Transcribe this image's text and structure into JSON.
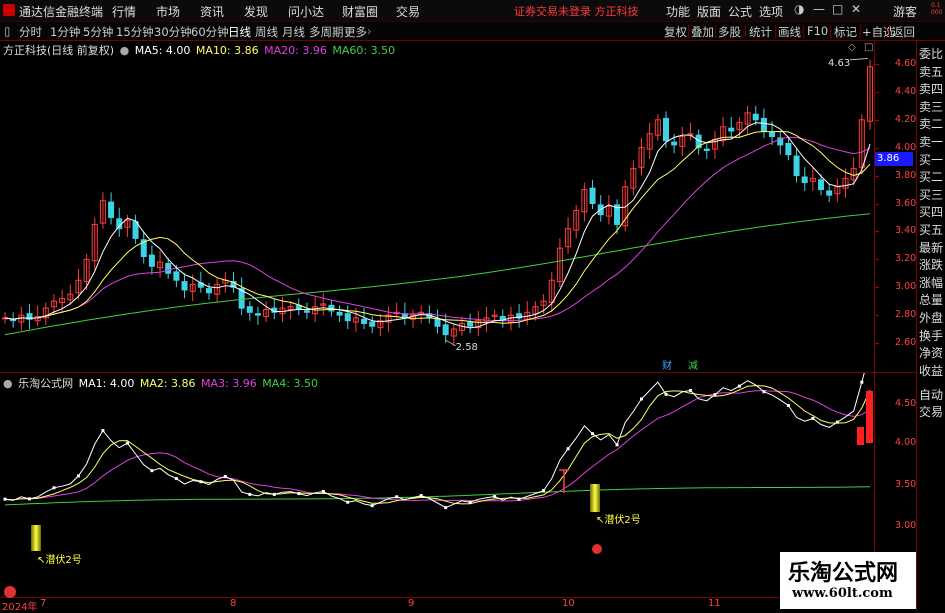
{
  "topbar": {
    "brand": "通达信金融终端",
    "menu": [
      "行情",
      "市场",
      "资讯",
      "发现",
      "问小达",
      "财富圈",
      "交易"
    ],
    "notice": "证券交易未登录 方正科技",
    "right_menu": [
      "功能",
      "版面",
      "公式",
      "选项"
    ],
    "guest": "游客",
    "badge": "0.1000"
  },
  "periodbar": {
    "periods": [
      "分时",
      "1分钟",
      "5分钟",
      "15分钟",
      "30分钟",
      "60分钟",
      "日线",
      "周线",
      "月线",
      "多周期",
      "更多"
    ],
    "active_period": "日线",
    "tools": [
      "复权",
      "叠加",
      "多股",
      "统计",
      "画线",
      "F10",
      "标记",
      "+自选",
      "返回"
    ]
  },
  "main_info": {
    "title": "方正科技(日线 前复权)",
    "ma5": "MA5: 4.00",
    "ma10": "MA10: 3.86",
    "ma20": "MA20: 3.96",
    "ma60": "MA60: 3.50"
  },
  "sub_info": {
    "title": "乐淘公式网",
    "ma1": "MA1: 4.00",
    "ma2": "MA2: 3.86",
    "ma3": "MA3: 3.96",
    "ma4": "MA4: 3.50"
  },
  "right_panel": [
    "委比",
    "卖五",
    "卖四",
    "卖三",
    "卖二",
    "卖一",
    "买一",
    "买二",
    "买三",
    "买四",
    "买五",
    "最新",
    "涨跌",
    "涨幅",
    "总量",
    "外盘",
    "换手",
    "净资",
    "收益"
  ],
  "right_panel_sub": [
    "自动",
    "交易"
  ],
  "price_axis": [
    "4.60",
    "4.40",
    "4.20",
    "4.00",
    "3.80",
    "3.60",
    "3.40",
    "3.20",
    "3.00",
    "2.80",
    "2.60"
  ],
  "current_price": "3.86",
  "high_mark": "4.63",
  "low_mark": "2.58",
  "sub_axis": [
    "4.50",
    "4.00",
    "3.50",
    "3.00"
  ],
  "dates": [
    "2024年",
    "7",
    "8",
    "9",
    "10",
    "11"
  ],
  "annotations": {
    "signal1": "潜伏2号",
    "signal2": "潜伏2号",
    "cai": "财",
    "jian": "减"
  },
  "watermark": {
    "name": "乐淘公式网",
    "url": "www.60lt.com"
  },
  "colors": {
    "up": "#ff3b3b",
    "down": "#3fd2e6",
    "ma5": "#ffffff",
    "ma10": "#ffff66",
    "ma20": "#e040e0",
    "ma60": "#40d040"
  }
}
